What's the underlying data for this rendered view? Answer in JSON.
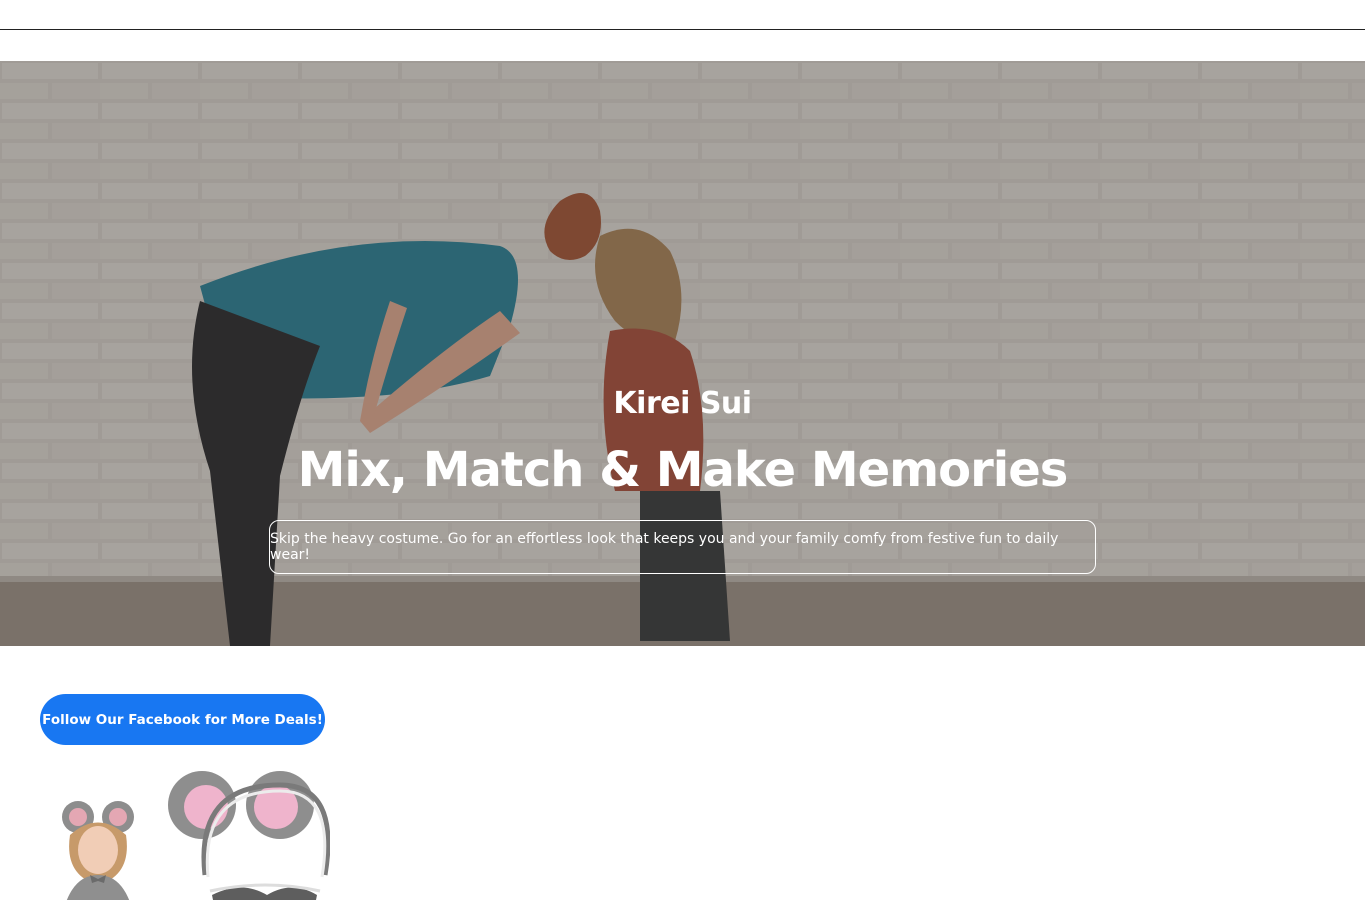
{
  "hero": {
    "brand": "Kirei Sui",
    "title": "Mix, Match & Make Memories",
    "description": "Skip the heavy costume. Go for an effortless look that keeps you and your family comfy from festive fun to daily wear!"
  },
  "promo": {
    "facebook_button_label": "Follow Our Facebook for More Deals!"
  },
  "colors": {
    "facebook_blue": "#1877f2",
    "hero_text": "#ffffff"
  }
}
